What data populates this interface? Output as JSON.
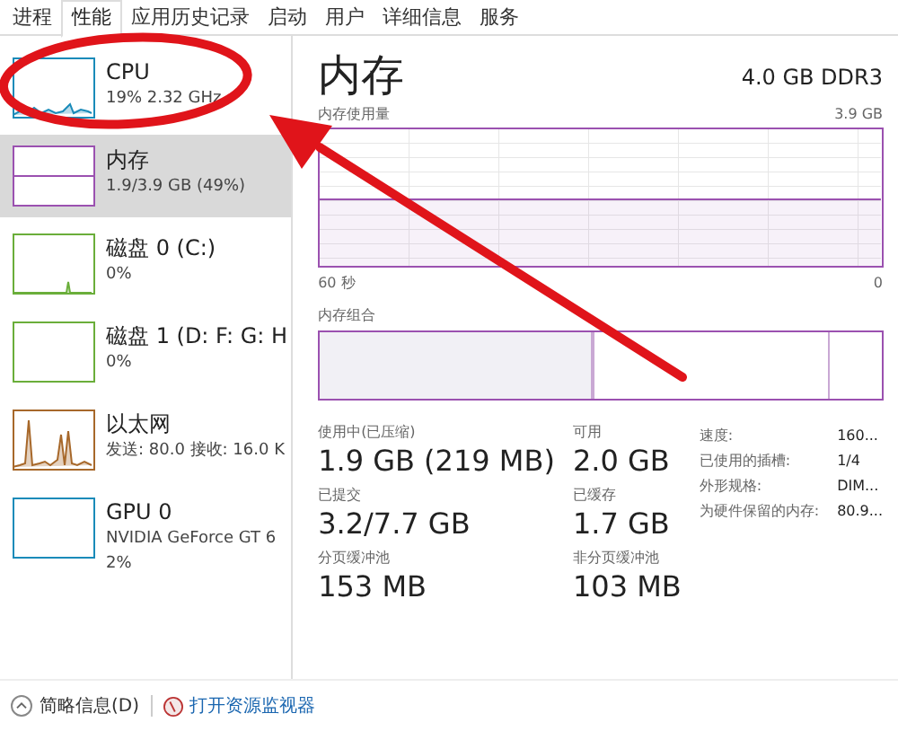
{
  "tabs": [
    {
      "label": "进程",
      "selected": false
    },
    {
      "label": "性能",
      "selected": true
    },
    {
      "label": "应用历史记录",
      "selected": false
    },
    {
      "label": "启动",
      "selected": false
    },
    {
      "label": "用户",
      "selected": false
    },
    {
      "label": "详细信息",
      "selected": false
    },
    {
      "label": "服务",
      "selected": false
    }
  ],
  "sidebar": {
    "items": [
      {
        "kind": "cpu",
        "name": "CPU",
        "detail": "19% 2.32 GHz",
        "color": "#1a8bb9",
        "selected": false
      },
      {
        "kind": "memory",
        "name": "内存",
        "detail": "1.9/3.9 GB (49%)",
        "color": "#9b51b0",
        "selected": true
      },
      {
        "kind": "disk",
        "name": "磁盘 0 (C:)",
        "detail": "0%",
        "color": "#6aae3a",
        "selected": false
      },
      {
        "kind": "disk_idle",
        "name": "磁盘 1 (D: F: G: H",
        "detail": "0%",
        "color": "#6aae3a",
        "selected": false
      },
      {
        "kind": "ethernet",
        "name": "以太网",
        "detail": "发送: 80.0 接收: 16.0 K",
        "color": "#a7682a",
        "selected": false
      },
      {
        "kind": "gpu",
        "name": "GPU 0",
        "detail": "NVIDIA GeForce GT 6",
        "detail2": "2%",
        "color": "#1a8bb9",
        "selected": false
      }
    ]
  },
  "main": {
    "title": "内存",
    "spec": "4.0 GB DDR3",
    "usage_label": "内存使用量",
    "usage_max": "3.9 GB",
    "time_start": "60 秒",
    "time_end": "0",
    "composition_label": "内存组合",
    "stats": [
      {
        "label": "使用中(已压缩)",
        "value": "1.9 GB (219 MB)"
      },
      {
        "label": "可用",
        "value": "2.0 GB"
      },
      {
        "label": "已提交",
        "value": "3.2/7.7 GB"
      },
      {
        "label": "已缓存",
        "value": "1.7 GB"
      },
      {
        "label": "分页缓冲池",
        "value": "153 MB"
      },
      {
        "label": "非分页缓冲池",
        "value": "103 MB"
      }
    ],
    "details": [
      {
        "label": "速度:",
        "value": "160..."
      },
      {
        "label": "已使用的插槽:",
        "value": "1/4"
      },
      {
        "label": "外形规格:",
        "value": "DIM..."
      },
      {
        "label": "为硬件保留的内存:",
        "value": "80.9..."
      }
    ]
  },
  "footer": {
    "summary": "简略信息(D)",
    "link": "打开资源监视器"
  }
}
